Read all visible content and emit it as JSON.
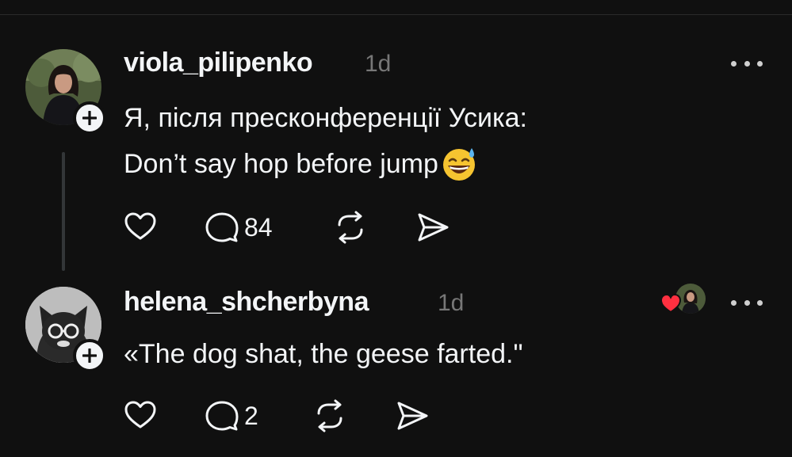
{
  "posts": [
    {
      "username": "viola_pilipenko",
      "time": "1d",
      "text_lines": [
        "Я, після пресконференції Усика:",
        "Don’t say hop before jump"
      ],
      "emoji": "😅",
      "reply_count": "84"
    },
    {
      "username": "helena_shcherbyna",
      "time": "1d",
      "text_lines": [
        "«The dog shat, the geese farted.\""
      ],
      "reply_count": "2"
    }
  ],
  "icons": {
    "like": "heart-icon",
    "reply": "comment-icon",
    "repost": "repost-icon",
    "share": "send-icon",
    "more": "more-icon",
    "follow": "plus-icon"
  },
  "colors": {
    "background": "#101010",
    "text": "#f3f5f7",
    "muted": "#777777",
    "heart": "#ff3040"
  }
}
